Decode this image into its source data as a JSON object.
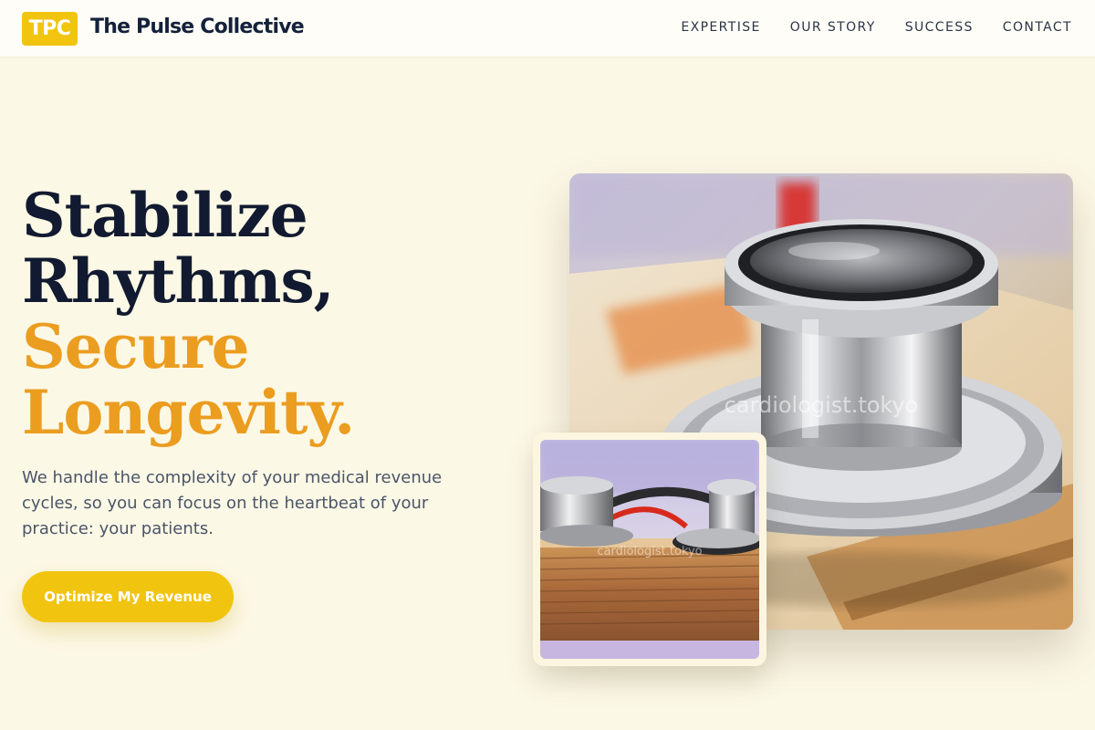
{
  "header": {
    "logo_text": "TPC",
    "brand_name": "The Pulse Collective",
    "nav": [
      "EXPERTISE",
      "OUR STORY",
      "SUCCESS",
      "CONTACT"
    ]
  },
  "hero": {
    "headline_line1": "Stabilize",
    "headline_line2": "Rhythms,",
    "headline_line3": "Secure",
    "headline_line4": "Longevity.",
    "subtext": "We handle the complexity of your medical revenue cycles, so you can focus on the heartbeat of your practice: your patients.",
    "cta_label": "Optimize My Revenue"
  },
  "images": {
    "main_watermark": "cardiologist.tokyo",
    "inset_watermark": "cardiologist.tokyo"
  },
  "colors": {
    "accent": "#f1c40f",
    "headline_dark": "#111a30",
    "headline_gold": "#eb9d20",
    "background": "#fcf8e6"
  }
}
